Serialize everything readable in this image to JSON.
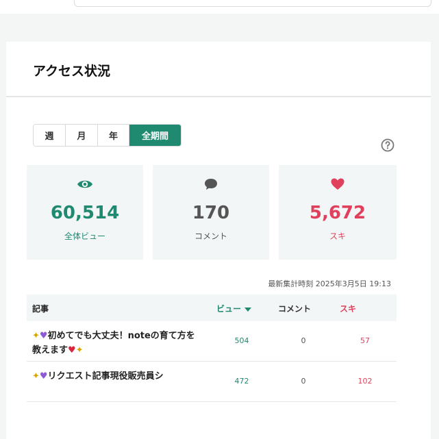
{
  "page": {
    "title": "アクセス状況"
  },
  "period_tabs": [
    {
      "label": "週",
      "active": false
    },
    {
      "label": "月",
      "active": false
    },
    {
      "label": "年",
      "active": false
    },
    {
      "label": "全期間",
      "active": true
    }
  ],
  "help": {
    "icon": "question-circle-icon"
  },
  "stats": {
    "views": {
      "value": "60,514",
      "label": "全体ビュー",
      "icon": "eye-icon",
      "color": "#1f8a70"
    },
    "comments": {
      "value": "170",
      "label": "コメント",
      "icon": "comment-bubble-icon",
      "color": "#555555"
    },
    "likes": {
      "value": "5,672",
      "label": "スキ",
      "icon": "heart-icon",
      "color": "#e0405c"
    }
  },
  "timestamp": "最新集計時刻 2025年3月5日 19:13",
  "table": {
    "headers": {
      "article": "記事",
      "views": "ビュー",
      "comments": "コメント",
      "likes": "スキ"
    },
    "rows": [
      {
        "title": "初めてでも大丈夫！noteの育て方を教えます",
        "views": "504",
        "comments": "0",
        "likes": "57"
      },
      {
        "title": "リクエスト記事現役販売員シ",
        "views": "472",
        "comments": "0",
        "likes": "102"
      }
    ]
  },
  "colors": {
    "accent": "#1f8a70",
    "like": "#e0405c",
    "stat_bg": "#f3f6f6"
  }
}
